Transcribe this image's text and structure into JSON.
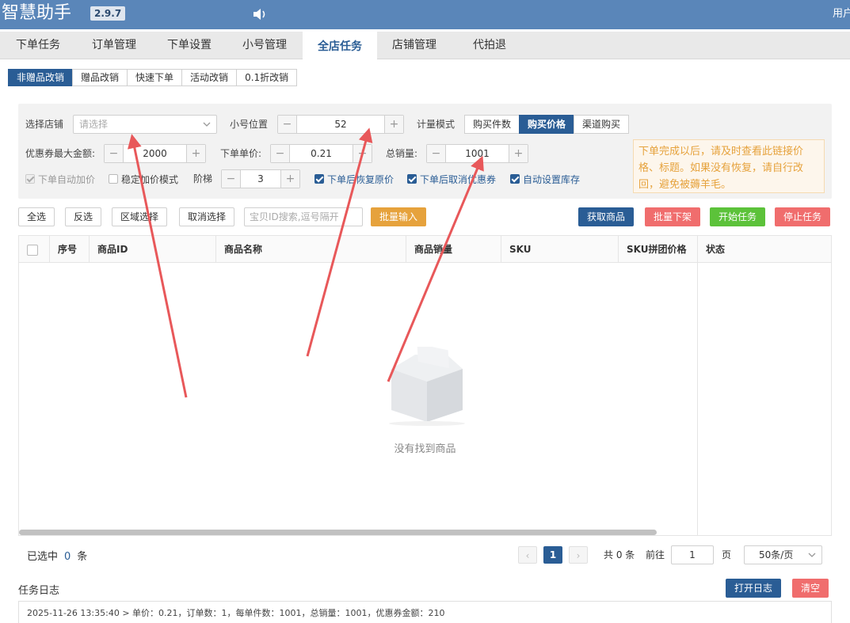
{
  "app": {
    "title": "智慧助手",
    "version": "2.9.7",
    "user_label": "用户"
  },
  "tabs": [
    "下单任务",
    "订单管理",
    "下单设置",
    "小号管理",
    "全店任务",
    "店铺管理",
    "代拍退"
  ],
  "active_tab": "全店任务",
  "subtabs": [
    "非赠品改销",
    "赠品改销",
    "快速下单",
    "活动改销",
    "0.1折改销"
  ],
  "active_subtab": "非赠品改销",
  "form": {
    "shop_label": "选择店铺",
    "shop_placeholder": "请选择",
    "position_label": "小号位置",
    "position_value": "52",
    "count_mode_label": "计量模式",
    "count_modes": [
      "购买件数",
      "购买价格",
      "渠道购买"
    ],
    "active_count_mode": "购买价格",
    "coupon_max_label": "优惠券最大金额:",
    "coupon_max_value": "2000",
    "unit_price_label": "下单单价:",
    "unit_price_value": "0.21",
    "total_sales_label": "总销量:",
    "total_sales_value": "1001",
    "auto_raise_label": "下单自动加价",
    "stable_price_label": "稳定加价模式",
    "ladder_label": "阶梯",
    "ladder_value": "3",
    "restore_price_label": "下单后恢复原价",
    "cancel_coupon_label": "下单后取消优惠券",
    "auto_stock_label": "自动设置库存",
    "notice": "下单完成以后，请及时查看此链接价格、标题。如果没有恢复，请自行改回，避免被薅羊毛。"
  },
  "toolbar": {
    "select_all": "全选",
    "invert": "反选",
    "region_select": "区域选择",
    "cancel_select": "取消选择",
    "search_placeholder": "宝贝ID搜索,逗号隔开",
    "batch_input": "批量输入",
    "fetch_goods": "获取商品",
    "batch_delist": "批量下架",
    "start_task": "开始任务",
    "stop_task": "停止任务"
  },
  "table": {
    "columns": [
      "序号",
      "商品ID",
      "商品名称",
      "商品销量",
      "SKU",
      "SKU拼团价格",
      "状态"
    ],
    "empty_text": "没有找到商品"
  },
  "footer": {
    "selected_prefix": "已选中",
    "selected_count": "0",
    "selected_suffix": "条",
    "current_page": "1",
    "total_text": "共 0 条",
    "goto_label": "前往",
    "goto_value": "1",
    "page_unit": "页",
    "page_size": "50条/页"
  },
  "log": {
    "title": "任务日志",
    "open_button": "打开日志",
    "clear_button": "清空",
    "lines": [
      "2025-11-26 13:35:40 > 单价：0.21，订单数：1，每单件数：1001，总销量：1001，优惠券金额：210"
    ]
  },
  "colors": {
    "header": "#5a86b9",
    "primary": "#2a5d95",
    "warning": "#e6a23c",
    "danger": "#f06d6d",
    "success": "#5cc23a",
    "annotation_arrow": "#e8585a"
  }
}
